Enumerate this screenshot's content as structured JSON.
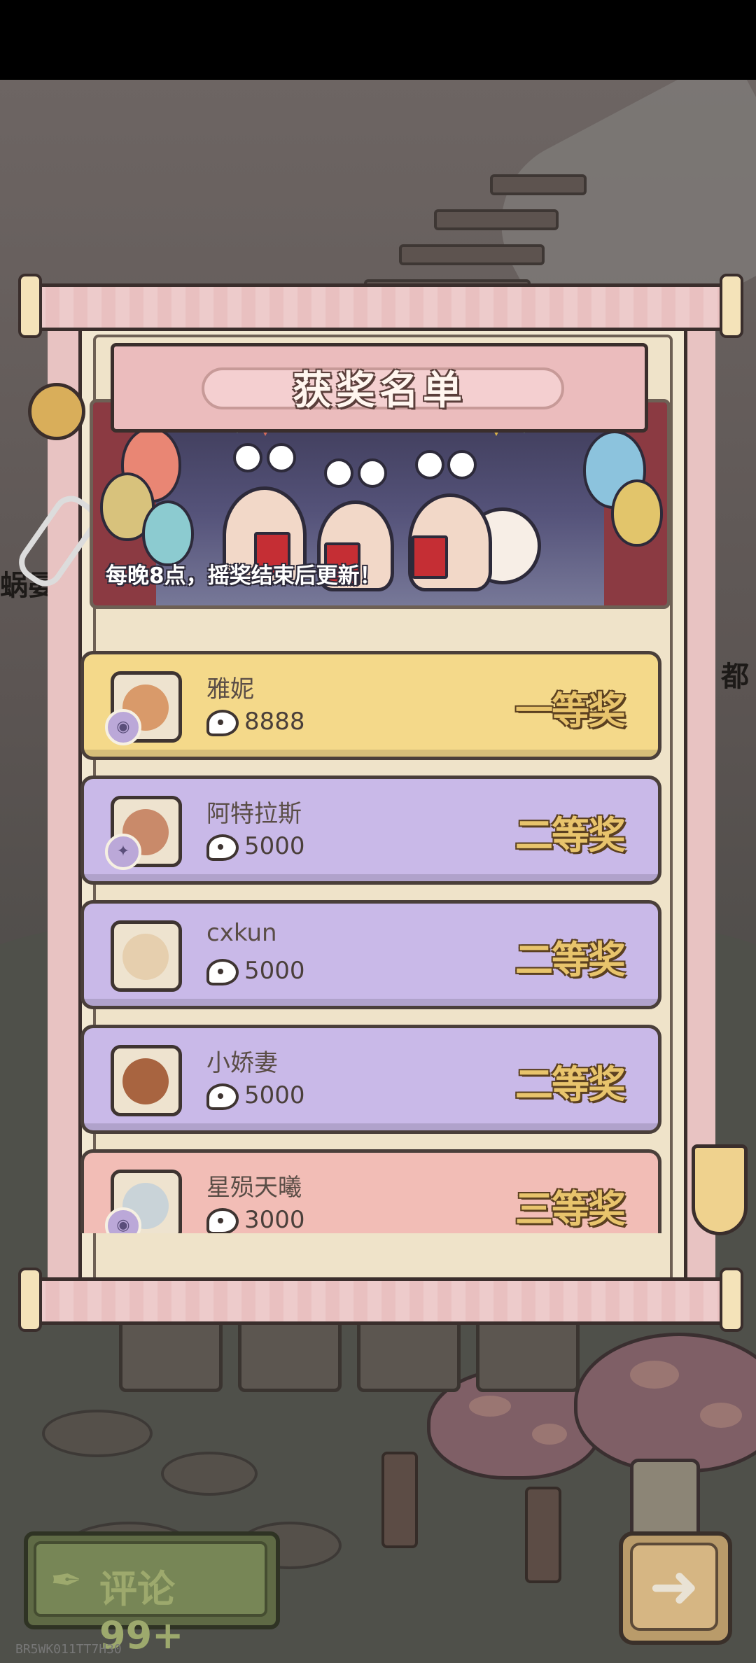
{
  "modal": {
    "title": "获奖名单",
    "banner_note": "每晚8点，摇奖结束后更新！"
  },
  "winners": [
    {
      "name": "雅妮",
      "coins": "8888",
      "prize": "一等奖",
      "tier": "gold"
    },
    {
      "name": "阿特拉斯",
      "coins": "5000",
      "prize": "二等奖",
      "tier": "purple"
    },
    {
      "name": "cxkun",
      "coins": "5000",
      "prize": "二等奖",
      "tier": "purple"
    },
    {
      "name": "小娇妻",
      "coins": "5000",
      "prize": "二等奖",
      "tier": "purple"
    },
    {
      "name": "星殒天曦",
      "coins": "3000",
      "prize": "三等奖",
      "tier": "pink"
    }
  ],
  "background": {
    "left_text": "蜗晏",
    "right_text": "都"
  },
  "footer": {
    "comment_label": "评论 99+",
    "next_icon": "arrow-right-icon",
    "build_id": "BR5WK011TT7H30"
  },
  "colors": {
    "gold_card": "#f4d98a",
    "purple_card": "#c9b9e8",
    "pink_card": "#f2bdb6",
    "title_board": "#ebbcbd"
  }
}
